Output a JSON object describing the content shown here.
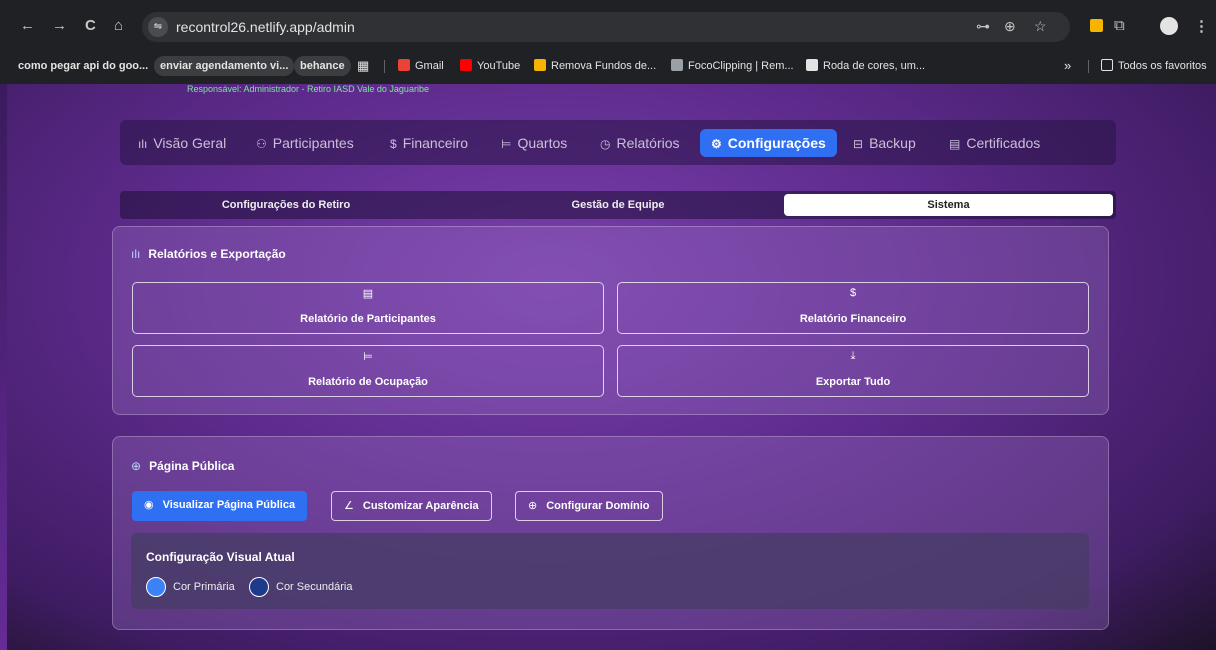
{
  "browser": {
    "url": "recontrol26.netlify.app/admin",
    "icons": {
      "back": "←",
      "forward": "→",
      "reload": "C",
      "home": "⌂",
      "site_info": "⇋",
      "password": "⊶",
      "zoom": "⊕",
      "star": "☆",
      "extension": "⧉",
      "menu": "⋮",
      "more": "»",
      "apps": "▦"
    },
    "bookmarks": [
      {
        "label": "como pegar api do goo...",
        "pill": false,
        "color": ""
      },
      {
        "label": "enviar agendamento vi...",
        "pill": true,
        "color": ""
      },
      {
        "label": "behance",
        "pill": true,
        "color": ""
      },
      {
        "label": "Gmail",
        "pill": false,
        "color": "#ea4335"
      },
      {
        "label": "YouTube",
        "pill": false,
        "color": "#ff0000"
      },
      {
        "label": "Remova Fundos de...",
        "pill": false,
        "color": "#f5b400"
      },
      {
        "label": "FocoClipping | Rem...",
        "pill": false,
        "color": "#9aa0a6"
      },
      {
        "label": "Roda de cores, um...",
        "pill": false,
        "color": "#e3e3e3"
      }
    ],
    "all_bookmarks": "Todos os favoritos"
  },
  "page": {
    "responsavel": "Responsável: Administrador - Retiro IASD Vale do Jaguaribe",
    "main_tabs": [
      {
        "label": "Visão Geral",
        "icon": "ılı"
      },
      {
        "label": "Participantes",
        "icon": "⚇"
      },
      {
        "label": "Financeiro",
        "icon": "$"
      },
      {
        "label": "Quartos",
        "icon": "⊨"
      },
      {
        "label": "Relatórios",
        "icon": "◷"
      },
      {
        "label": "Configurações",
        "icon": "⚙"
      },
      {
        "label": "Backup",
        "icon": "⊟"
      },
      {
        "label": "Certificados",
        "icon": "▤"
      }
    ],
    "sub_tabs": [
      "Configurações do Retiro",
      "Gestão de Equipe",
      "Sistema"
    ],
    "reports": {
      "title": "Relatórios e Exportação",
      "title_icon": "ılı",
      "buttons": [
        {
          "label": "Relatório de Participantes",
          "icon": "▤"
        },
        {
          "label": "Relatório Financeiro",
          "icon": "$"
        },
        {
          "label": "Relatório de Ocupação",
          "icon": "⊨"
        },
        {
          "label": "Exportar Tudo",
          "icon": "⤓"
        }
      ]
    },
    "public": {
      "title": "Página Pública",
      "title_icon": "⊕",
      "buttons": [
        {
          "label": "Visualizar Página Pública",
          "icon": "◉"
        },
        {
          "label": "Customizar Aparência",
          "icon": "∠"
        },
        {
          "label": "Configurar Domínio",
          "icon": "⊕"
        }
      ],
      "visual": {
        "title": "Configuração Visual Atual",
        "primary_label": "Cor Primária",
        "secondary_label": "Cor Secundária",
        "primary_color": "#3b82f6",
        "secondary_color": "#1e3a8a"
      }
    }
  }
}
